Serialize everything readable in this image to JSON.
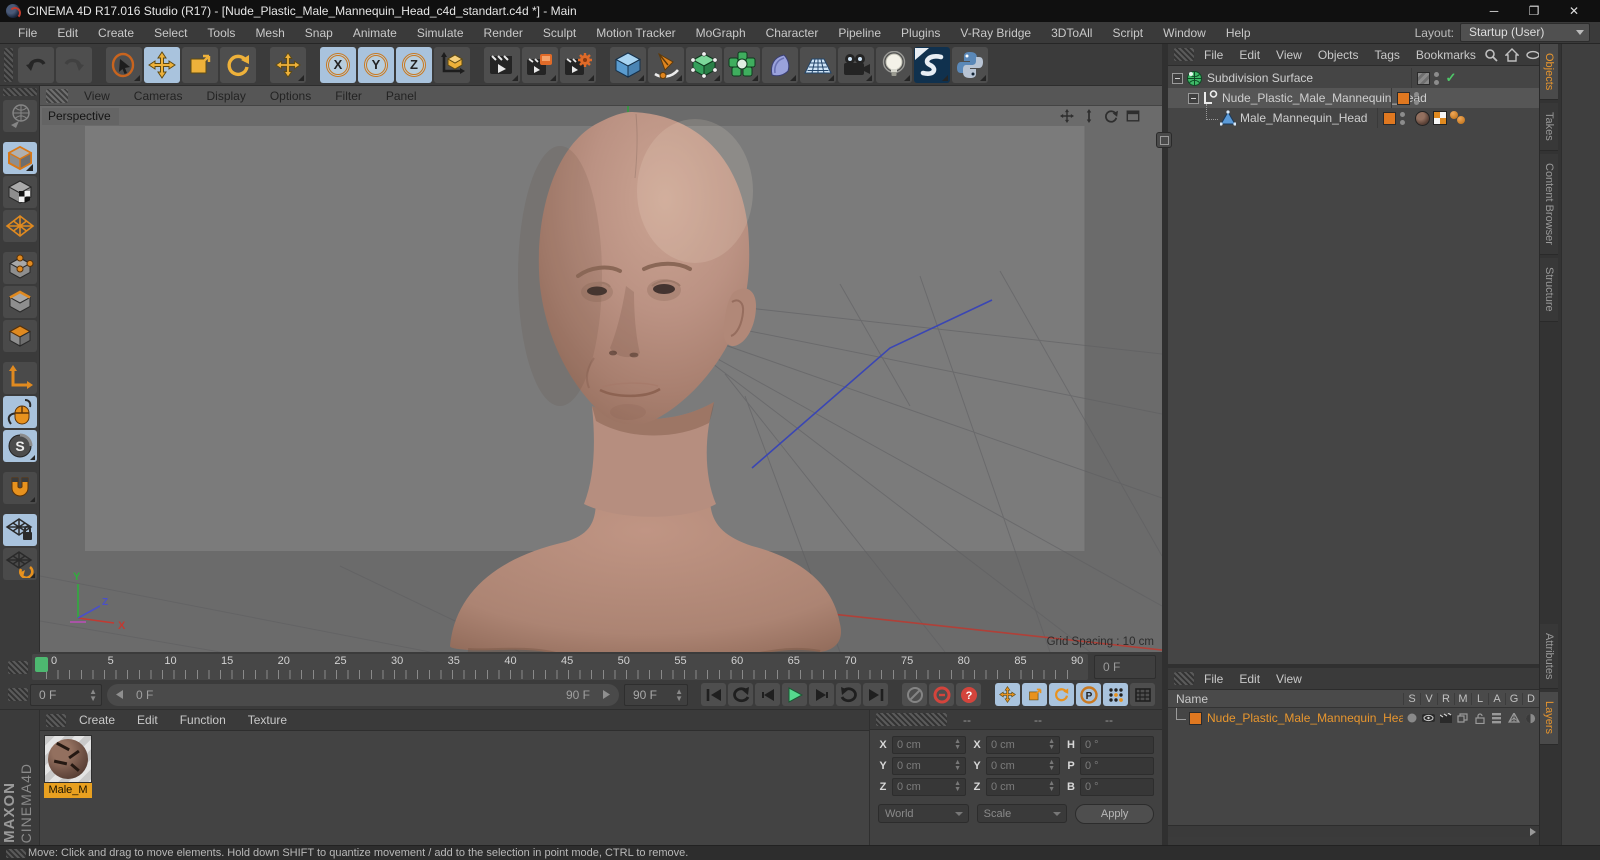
{
  "window": {
    "title": "CINEMA 4D R17.016 Studio (R17) - [Nude_Plastic_Male_Mannequin_Head_c4d_standart.c4d *] - Main"
  },
  "menubar": {
    "items": [
      "File",
      "Edit",
      "Create",
      "Select",
      "Tools",
      "Mesh",
      "Snap",
      "Animate",
      "Simulate",
      "Render",
      "Sculpt",
      "Motion Tracker",
      "MoGraph",
      "Character",
      "Pipeline",
      "Plugins",
      "V-Ray Bridge",
      "3DToAll",
      "Script",
      "Window",
      "Help"
    ],
    "layout_label": "Layout:",
    "layout_value": "Startup (User)"
  },
  "toolbar": {
    "buttons": [
      "undo",
      "redo",
      "live-selection",
      "move",
      "scale",
      "rotate",
      "last-tool-move",
      "lock-x",
      "lock-y",
      "lock-z",
      "coordinate-system",
      "render-view",
      "render-to-picture-viewer",
      "edit-render-settings",
      "add-cube-primitive",
      "spline-pen",
      "subdivision-surface",
      "mograph-cloner",
      "deformer",
      "floor-environment",
      "camera",
      "light",
      "sketch-and-toon",
      "python-script"
    ],
    "axis_x": "X",
    "axis_y": "Y",
    "axis_z": "Z"
  },
  "left_toolbar": {
    "buttons": [
      "make-editable",
      "model-mode",
      "texture-mode",
      "workplane-mode",
      "points-mode",
      "edges-mode",
      "polygons-mode",
      "enable-axis",
      "tweak-mode",
      "enable-snap",
      "magnet-snap",
      "lock-workplane",
      "workplane-transform"
    ],
    "snap_letter": "S"
  },
  "viewport": {
    "menu": [
      "View",
      "Cameras",
      "Display",
      "Options",
      "Filter",
      "Panel"
    ],
    "view_label": "Perspective",
    "grid_spacing": "Grid Spacing : 10 cm",
    "nav_icons": [
      "pan",
      "zoom",
      "rotate",
      "maximize"
    ],
    "axis_gizmo": {
      "x": "X",
      "y": "Y",
      "z": "Z"
    }
  },
  "object_manager": {
    "menu": [
      "File",
      "Edit",
      "View",
      "Objects",
      "Tags",
      "Bookmarks"
    ],
    "header_icons": [
      "search",
      "home",
      "visibility",
      "add-panel"
    ],
    "items": [
      {
        "name": "Subdivision Surface",
        "icon": "subdivision-surface-object"
      },
      {
        "name": "Nude_Plastic_Male_Mannequin_Head",
        "icon": "null-object",
        "selected": true
      },
      {
        "name": "Male_Mannequin_Head",
        "icon": "polygon-object",
        "tags": [
          "material-tag",
          "uvw-tag",
          "phong-tag"
        ]
      }
    ]
  },
  "right_tabs": {
    "top": [
      {
        "label": "Objects",
        "active": true
      },
      {
        "label": "Takes"
      },
      {
        "label": "Content Browser"
      },
      {
        "label": "Structure"
      }
    ],
    "bottom": [
      {
        "label": "Attributes"
      },
      {
        "label": "Layers",
        "active": true
      }
    ]
  },
  "timeline": {
    "ticks": [
      "0",
      "5",
      "10",
      "15",
      "20",
      "25",
      "30",
      "35",
      "40",
      "45",
      "50",
      "55",
      "60",
      "65",
      "70",
      "75",
      "80",
      "85",
      "90"
    ],
    "frame_display": "0 F",
    "current_frame": "0 F",
    "slider_start": "0 F",
    "slider_end": "90 F",
    "max_frame": "90 F"
  },
  "transport": {
    "playback": [
      "go-to-start",
      "play-backwards",
      "previous-frame",
      "play-forwards",
      "next-frame",
      "play-loop",
      "go-to-end"
    ],
    "record": [
      "record-active-objects",
      "autokeying",
      "help"
    ],
    "key_toggles": [
      "record-position",
      "record-scale",
      "record-rotation",
      "record-parameter",
      "record-point-level"
    ],
    "parameter_letter": "P"
  },
  "material_manager": {
    "menu": [
      "Create",
      "Edit",
      "Function",
      "Texture"
    ],
    "materials": [
      {
        "name": "Male_M"
      }
    ]
  },
  "coordinates": {
    "headers": [
      "--",
      "--",
      "--"
    ],
    "rows": [
      {
        "l1": "X",
        "v1": "0 cm",
        "l2": "X",
        "v2": "0 cm",
        "l3": "H",
        "v3": "0 °"
      },
      {
        "l1": "Y",
        "v1": "0 cm",
        "l2": "Y",
        "v2": "0 cm",
        "l3": "P",
        "v3": "0 °"
      },
      {
        "l1": "Z",
        "v1": "0 cm",
        "l2": "Z",
        "v2": "0 cm",
        "l3": "B",
        "v3": "0 °"
      }
    ],
    "dropdown_left": "World",
    "dropdown_right": "Scale",
    "apply_label": "Apply"
  },
  "layers_panel": {
    "menu": [
      "File",
      "Edit",
      "View"
    ],
    "name_header": "Name",
    "columns": [
      "S",
      "V",
      "R",
      "M",
      "L",
      "A",
      "G",
      "D"
    ],
    "rows": [
      {
        "name": "Nude_Plastic_Male_Mannequin_Head"
      }
    ]
  },
  "status_bar": {
    "text": "Move: Click and drag to move elements. Hold down SHIFT to quantize movement / add to the selection in point mode, CTRL to remove."
  },
  "brand": {
    "line1": "MAXON",
    "line2": "CINEMA4D"
  },
  "colors": {
    "accent_orange": "#e8922a",
    "active_blue": "#a9c3dd",
    "playhead_green": "#4db870",
    "selection_bg": "#565656",
    "viewport_bg": "#6b6b6b",
    "skin": "#bb9283"
  }
}
